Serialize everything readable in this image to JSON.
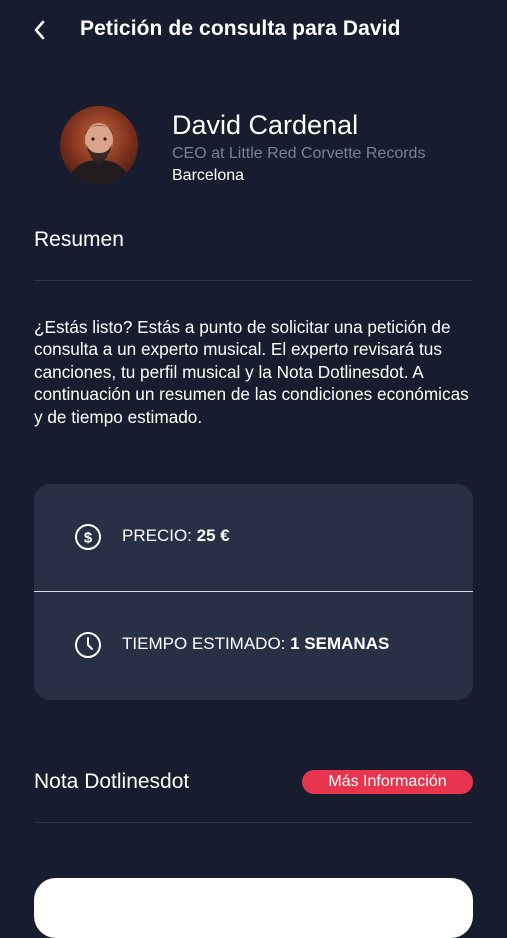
{
  "header": {
    "title": "Petición de consulta para David"
  },
  "profile": {
    "name": "David Cardenal",
    "role": "CEO at Little Red Corvette Records",
    "city": "Barcelona"
  },
  "summary": {
    "title": "Resumen",
    "text": "¿Estás listo? Estás a punto de solicitar una petición de consulta a un experto musical. El experto revisará tus canciones, tu perfil musical y la Nota Dotlinesdot. A continuación un resumen de las condiciones económicas y de tiempo estimado."
  },
  "card": {
    "price_label": "PRECIO: ",
    "price_value": "25 €",
    "time_label": "TIEMPO ESTIMADO: ",
    "time_value": "1 SEMANAS"
  },
  "nota": {
    "label": "Nota Dotlinesdot",
    "more_info": "Más Información"
  },
  "colors": {
    "background": "#171c2e",
    "card": "#283045",
    "accent": "#e8344f"
  },
  "icons": [
    "chevron-left-icon",
    "dollar-circle-icon",
    "clock-icon"
  ]
}
